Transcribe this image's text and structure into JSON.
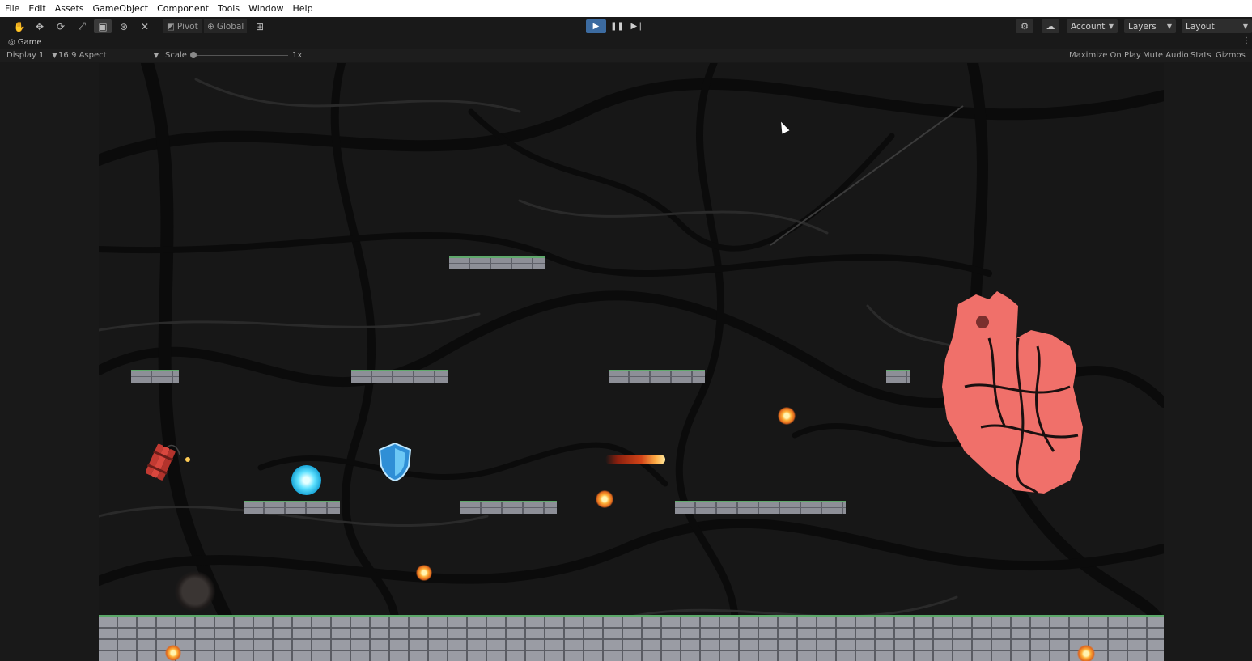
{
  "menu": [
    "File",
    "Edit",
    "Assets",
    "GameObject",
    "Component",
    "Tools",
    "Window",
    "Help"
  ],
  "toolbar": {
    "pivot_label": "Pivot",
    "global_label": "Global",
    "account_label": "Account",
    "layers_label": "Layers",
    "layout_label": "Layout",
    "play_state": "playing"
  },
  "tab": {
    "label": "Game"
  },
  "game_toolbar": {
    "display": "Display 1",
    "aspect": "16:9 Aspect",
    "scale_label": "Scale",
    "scale_value": "1x",
    "maximize_on_play": "Maximize On Play",
    "mute_audio": "Mute Audio",
    "stats": "Stats",
    "gizmos": "Gizmos"
  },
  "colors": {
    "accent": "#3c6ba0",
    "heart": "#f0706a",
    "platform_moss": "#5fa86b"
  }
}
